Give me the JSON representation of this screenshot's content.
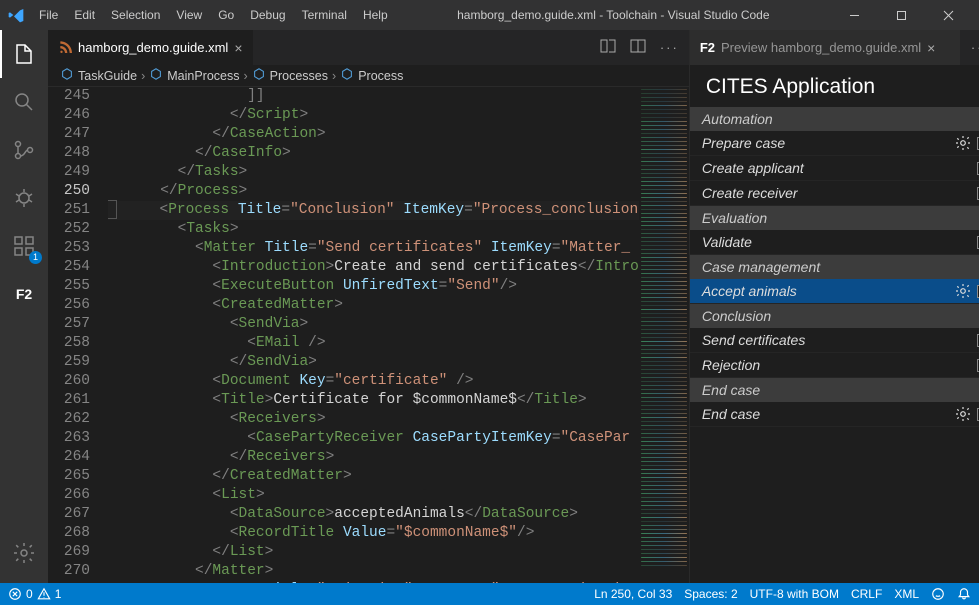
{
  "titlebar": {
    "menu": [
      "File",
      "Edit",
      "Selection",
      "View",
      "Go",
      "Debug",
      "Terminal",
      "Help"
    ],
    "title": "hamborg_demo.guide.xml - Toolchain - Visual Studio Code"
  },
  "activitybar": {
    "f2_label": "F2",
    "extensions_badge": "1"
  },
  "editor": {
    "tab": {
      "filename": "hamborg_demo.guide.xml",
      "icon": "rss-icon"
    },
    "breadcrumbs": [
      "TaskGuide",
      "MainProcess",
      "Processes",
      "Process"
    ],
    "first_line_no": 245,
    "current_line_no": 250,
    "lines": [
      {
        "indent": 16,
        "tokens": [
          [
            "br",
            "]]"
          ]
        ]
      },
      {
        "indent": 14,
        "tokens": [
          [
            "br",
            "</"
          ],
          [
            "tag",
            "Script"
          ],
          [
            "br",
            ">"
          ]
        ]
      },
      {
        "indent": 12,
        "tokens": [
          [
            "br",
            "</"
          ],
          [
            "tag",
            "CaseAction"
          ],
          [
            "br",
            ">"
          ]
        ]
      },
      {
        "indent": 10,
        "tokens": [
          [
            "br",
            "</"
          ],
          [
            "tag",
            "CaseInfo"
          ],
          [
            "br",
            ">"
          ]
        ]
      },
      {
        "indent": 8,
        "tokens": [
          [
            "br",
            "</"
          ],
          [
            "tag",
            "Tasks"
          ],
          [
            "br",
            ">"
          ]
        ]
      },
      {
        "indent": 6,
        "tokens": [
          [
            "br",
            "</"
          ],
          [
            "tag",
            "Process"
          ],
          [
            "br",
            ">"
          ]
        ]
      },
      {
        "indent": 6,
        "current": true,
        "tokens": [
          [
            "br",
            "<"
          ],
          [
            "tag",
            "Process"
          ],
          [
            "txt",
            " "
          ],
          [
            "attr",
            "Title"
          ],
          [
            "br",
            "="
          ],
          [
            "str",
            "\"Conclusion\""
          ],
          [
            "txt",
            " "
          ],
          [
            "attr",
            "ItemKey"
          ],
          [
            "br",
            "="
          ],
          [
            "str",
            "\"Process_conclusion"
          ]
        ]
      },
      {
        "indent": 8,
        "tokens": [
          [
            "br",
            "<"
          ],
          [
            "tag",
            "Tasks"
          ],
          [
            "br",
            ">"
          ]
        ]
      },
      {
        "indent": 10,
        "tokens": [
          [
            "br",
            "<"
          ],
          [
            "tag",
            "Matter"
          ],
          [
            "txt",
            " "
          ],
          [
            "attr",
            "Title"
          ],
          [
            "br",
            "="
          ],
          [
            "str",
            "\"Send certificates\""
          ],
          [
            "txt",
            " "
          ],
          [
            "attr",
            "ItemKey"
          ],
          [
            "br",
            "="
          ],
          [
            "str",
            "\"Matter_"
          ]
        ]
      },
      {
        "indent": 12,
        "tokens": [
          [
            "br",
            "<"
          ],
          [
            "tag",
            "Introduction"
          ],
          [
            "br",
            ">"
          ],
          [
            "txt",
            "Create and send certificates"
          ],
          [
            "br",
            "</"
          ],
          [
            "tag",
            "Intro"
          ]
        ]
      },
      {
        "indent": 12,
        "tokens": [
          [
            "br",
            "<"
          ],
          [
            "tag",
            "ExecuteButton"
          ],
          [
            "txt",
            " "
          ],
          [
            "attr",
            "UnfiredText"
          ],
          [
            "br",
            "="
          ],
          [
            "str",
            "\"Send\""
          ],
          [
            "br",
            "/>"
          ]
        ]
      },
      {
        "indent": 12,
        "tokens": [
          [
            "br",
            "<"
          ],
          [
            "tag",
            "CreatedMatter"
          ],
          [
            "br",
            ">"
          ]
        ]
      },
      {
        "indent": 14,
        "tokens": [
          [
            "br",
            "<"
          ],
          [
            "tag",
            "SendVia"
          ],
          [
            "br",
            ">"
          ]
        ]
      },
      {
        "indent": 16,
        "tokens": [
          [
            "br",
            "<"
          ],
          [
            "tag",
            "EMail"
          ],
          [
            "txt",
            " "
          ],
          [
            "br",
            "/>"
          ]
        ]
      },
      {
        "indent": 14,
        "tokens": [
          [
            "br",
            "</"
          ],
          [
            "tag",
            "SendVia"
          ],
          [
            "br",
            ">"
          ]
        ]
      },
      {
        "indent": 12,
        "tokens": [
          [
            "br",
            "<"
          ],
          [
            "tag",
            "Document"
          ],
          [
            "txt",
            " "
          ],
          [
            "attr",
            "Key"
          ],
          [
            "br",
            "="
          ],
          [
            "str",
            "\"certificate\""
          ],
          [
            "txt",
            " "
          ],
          [
            "br",
            "/>"
          ]
        ]
      },
      {
        "indent": 12,
        "tokens": [
          [
            "br",
            "<"
          ],
          [
            "tag",
            "Title"
          ],
          [
            "br",
            ">"
          ],
          [
            "txt",
            "Certificate for $commonName$"
          ],
          [
            "br",
            "</"
          ],
          [
            "tag",
            "Title"
          ],
          [
            "br",
            ">"
          ]
        ]
      },
      {
        "indent": 14,
        "tokens": [
          [
            "br",
            "<"
          ],
          [
            "tag",
            "Receivers"
          ],
          [
            "br",
            ">"
          ]
        ]
      },
      {
        "indent": 16,
        "tokens": [
          [
            "br",
            "<"
          ],
          [
            "tag",
            "CasePartyReceiver"
          ],
          [
            "txt",
            " "
          ],
          [
            "attr",
            "CasePartyItemKey"
          ],
          [
            "br",
            "="
          ],
          [
            "str",
            "\"CasePar"
          ]
        ]
      },
      {
        "indent": 14,
        "tokens": [
          [
            "br",
            "</"
          ],
          [
            "tag",
            "Receivers"
          ],
          [
            "br",
            ">"
          ]
        ]
      },
      {
        "indent": 12,
        "tokens": [
          [
            "br",
            "</"
          ],
          [
            "tag",
            "CreatedMatter"
          ],
          [
            "br",
            ">"
          ]
        ]
      },
      {
        "indent": 12,
        "tokens": [
          [
            "br",
            "<"
          ],
          [
            "tag",
            "List"
          ],
          [
            "br",
            ">"
          ]
        ]
      },
      {
        "indent": 14,
        "tokens": [
          [
            "br",
            "<"
          ],
          [
            "tag",
            "DataSource"
          ],
          [
            "br",
            ">"
          ],
          [
            "txt",
            "acceptedAnimals"
          ],
          [
            "br",
            "</"
          ],
          [
            "tag",
            "DataSource"
          ],
          [
            "br",
            ">"
          ]
        ]
      },
      {
        "indent": 14,
        "tokens": [
          [
            "br",
            "<"
          ],
          [
            "tag",
            "RecordTitle"
          ],
          [
            "txt",
            " "
          ],
          [
            "attr",
            "Value"
          ],
          [
            "br",
            "="
          ],
          [
            "str",
            "\"$commonName$\""
          ],
          [
            "br",
            "/>"
          ]
        ]
      },
      {
        "indent": 12,
        "tokens": [
          [
            "br",
            "</"
          ],
          [
            "tag",
            "List"
          ],
          [
            "br",
            ">"
          ]
        ]
      },
      {
        "indent": 10,
        "tokens": [
          [
            "br",
            "</"
          ],
          [
            "tag",
            "Matter"
          ],
          [
            "br",
            ">"
          ]
        ]
      },
      {
        "indent": 10,
        "tokens": [
          [
            "br",
            "<"
          ],
          [
            "tag",
            "Matter"
          ],
          [
            "txt",
            " "
          ],
          [
            "attr",
            "Title"
          ],
          [
            "br",
            "="
          ],
          [
            "str",
            "\"Rejection\""
          ],
          [
            "txt",
            " "
          ],
          [
            "attr",
            "ItemKey"
          ],
          [
            "br",
            "="
          ],
          [
            "str",
            "\"Matter_rejection"
          ]
        ]
      }
    ]
  },
  "preview": {
    "tab_prefix": "F2",
    "tab_label": "Preview hamborg_demo.guide.xml",
    "app_title": "CITES Application",
    "sections": [
      {
        "header": "Automation",
        "rows": [
          {
            "label": "Prepare case",
            "gear": true,
            "chk": true
          },
          {
            "label": "Create applicant",
            "gear": false,
            "chk": true
          },
          {
            "label": "Create receiver",
            "gear": false,
            "chk": true
          }
        ]
      },
      {
        "header": "Evaluation",
        "rows": [
          {
            "label": "Validate",
            "gear": false,
            "chk": true
          }
        ]
      },
      {
        "header": "Case management",
        "rows": [
          {
            "label": "Accept animals",
            "gear": true,
            "chk": true,
            "selected": true
          }
        ]
      },
      {
        "header": "Conclusion",
        "rows": [
          {
            "label": "Send certificates",
            "gear": false,
            "chk": true
          },
          {
            "label": "Rejection",
            "gear": false,
            "chk": true
          }
        ]
      },
      {
        "header": "End case",
        "rows": [
          {
            "label": "End case",
            "gear": true,
            "chk": true
          }
        ]
      }
    ]
  },
  "status": {
    "errors": "0",
    "warnings": "1",
    "cursor": "Ln 250, Col 33",
    "spaces": "Spaces: 2",
    "encoding": "UTF-8 with BOM",
    "eol": "CRLF",
    "lang": "XML"
  }
}
